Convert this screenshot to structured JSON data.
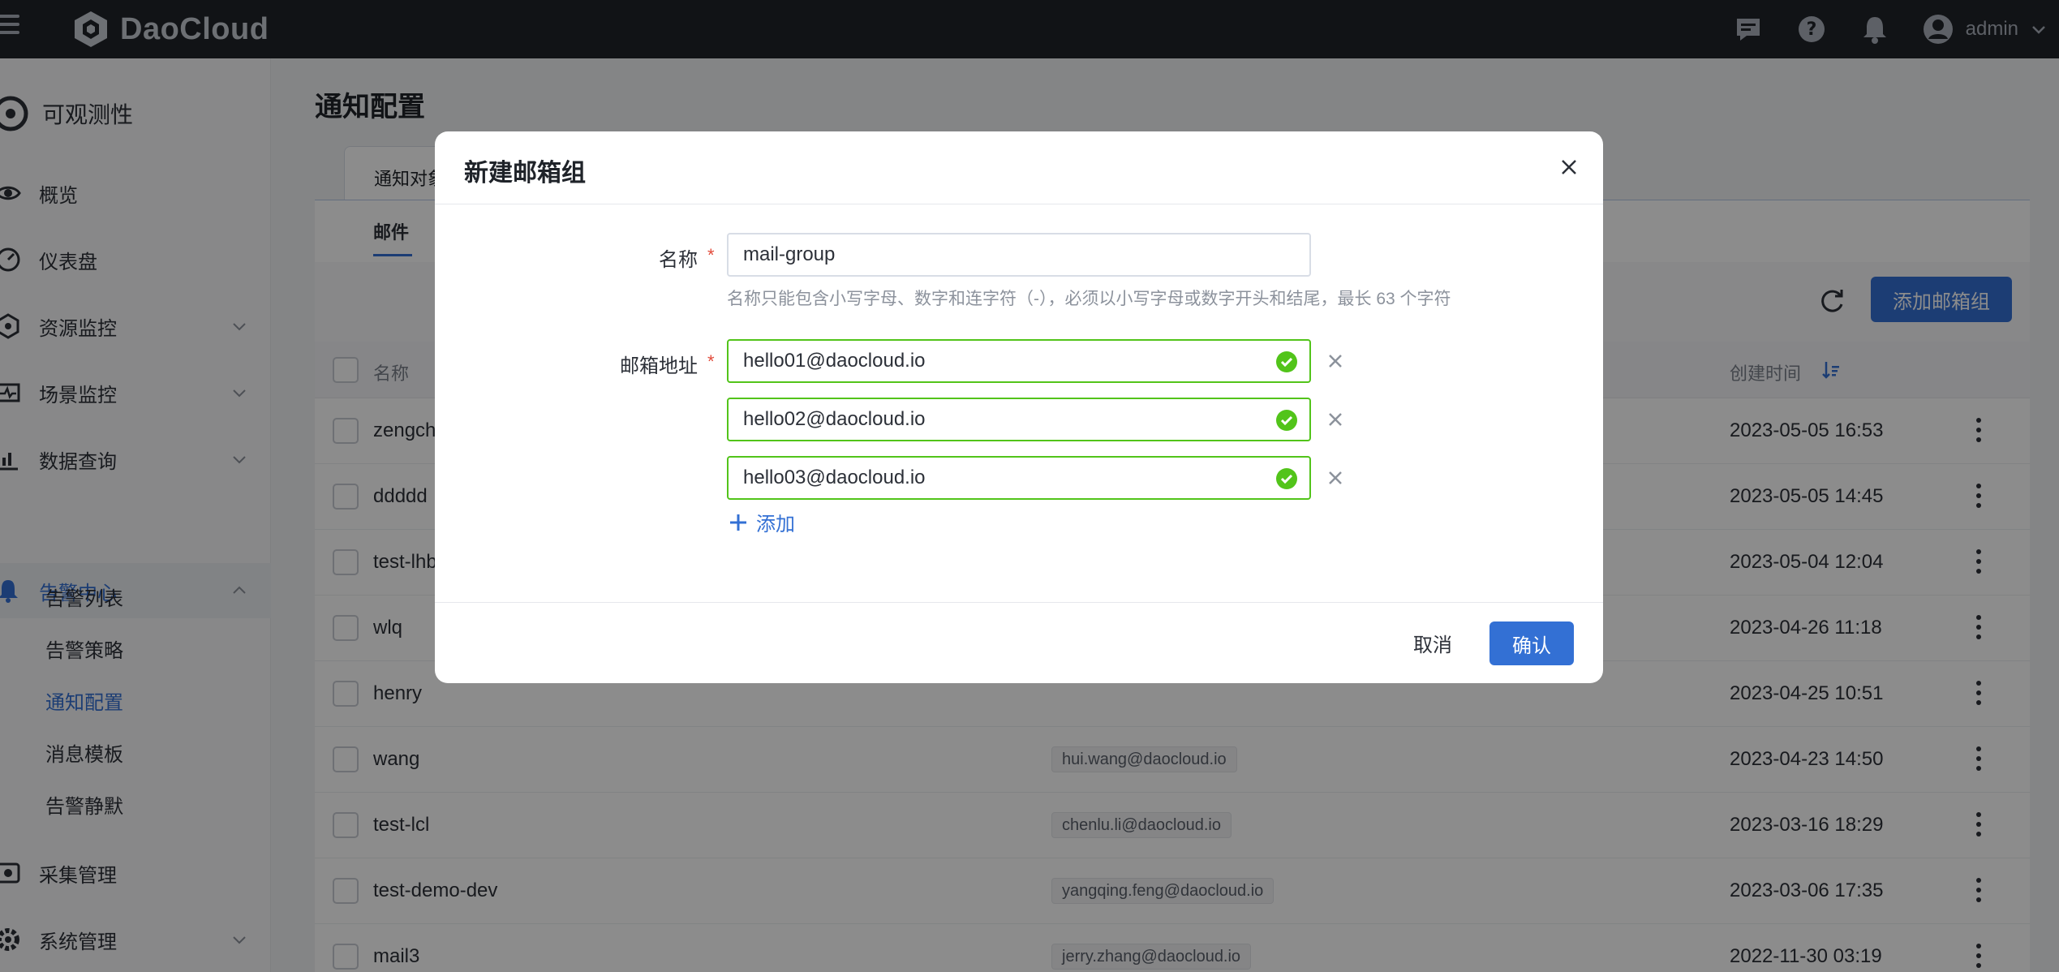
{
  "topbar": {
    "brand": "DaoCloud",
    "user_name": "admin",
    "icons": [
      "message-icon",
      "help-icon",
      "bell-icon",
      "user-avatar-icon"
    ]
  },
  "sidebar": {
    "module_title": "可观测性",
    "items": [
      {
        "label": "概览",
        "icon": "eye-icon"
      },
      {
        "label": "仪表盘",
        "icon": "dashboard-icon"
      },
      {
        "label": "资源监控",
        "icon": "hexagon-icon"
      },
      {
        "label": "场景监控",
        "icon": "pulse-icon"
      },
      {
        "label": "数据查询",
        "icon": "query-icon"
      },
      {
        "label": "告警中心",
        "icon": "bell-icon"
      },
      {
        "label": "采集管理",
        "icon": "collect-icon"
      },
      {
        "label": "系统管理",
        "icon": "gear-icon"
      }
    ],
    "sub_items": [
      "告警列表",
      "告警策略",
      "通知配置",
      "消息模板",
      "告警静默"
    ]
  },
  "main": {
    "page_title": "通知配置",
    "tab_label": "通知对象",
    "subtab_label": "邮件",
    "add_button": "添加邮箱组",
    "columns": {
      "name": "名称",
      "created": "创建时间"
    },
    "rows": [
      {
        "name": "zengch",
        "email": "",
        "time": "2023-05-05 16:53"
      },
      {
        "name": "ddddd",
        "email": "",
        "time": "2023-05-05 14:45"
      },
      {
        "name": "test-lhb",
        "email": "",
        "time": "2023-05-04 12:04"
      },
      {
        "name": "wlq",
        "email": "",
        "time": "2023-04-26 11:18"
      },
      {
        "name": "henry",
        "email": "",
        "time": "2023-04-25 10:51"
      },
      {
        "name": "wang",
        "email": "hui.wang@daocloud.io",
        "time": "2023-04-23 14:50"
      },
      {
        "name": "test-lcl",
        "email": "chenlu.li@daocloud.io",
        "time": "2023-03-16 18:29"
      },
      {
        "name": "test-demo-dev",
        "email": "yangqing.feng@daocloud.io",
        "time": "2023-03-06 17:35"
      },
      {
        "name": "mail3",
        "email": "jerry.zhang@daocloud.io",
        "time": "2022-11-30 03:19"
      }
    ]
  },
  "modal": {
    "title": "新建邮箱组",
    "name_label": "名称",
    "required_mark": "*",
    "name_value": "mail-group",
    "name_hint": "名称只能包含小写字母、数字和连字符（-），必须以小写字母或数字开头和结尾，最长 63 个字符",
    "email_label": "邮箱地址",
    "emails": [
      "hello01@daocloud.io",
      "hello02@daocloud.io",
      "hello03@daocloud.io"
    ],
    "add_label": "添加",
    "cancel_label": "取消",
    "confirm_label": "确认"
  },
  "colors": {
    "primary": "#3370d4",
    "topbar": "#1f2329",
    "success": "#52c41a",
    "required": "#e24b3b"
  }
}
